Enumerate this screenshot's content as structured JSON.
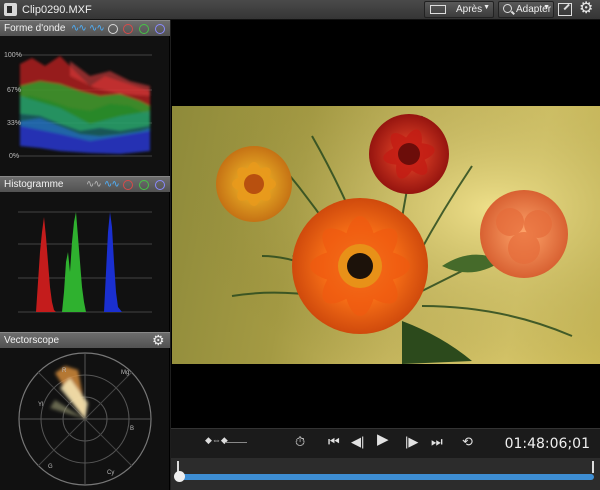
{
  "window": {
    "file_name": "Clip0290.MXF",
    "view_label": "Après",
    "fit_label": "Adapter",
    "app_icon": "clip-viewer-icon",
    "settings_icon": "gear-icon",
    "external_icon": "external-monitor-icon"
  },
  "waveform": {
    "title": "Forme d'onde",
    "levels": [
      "100%",
      "67%",
      "33%",
      "0%"
    ],
    "modes": [
      "rgb-parade-wave-icon",
      "luma-wave-icon"
    ],
    "channels": [
      "white",
      "red",
      "green",
      "blue"
    ],
    "colors": {
      "white": "#d8d8d8",
      "red": "#d84a4a",
      "green": "#46c446",
      "blue": "#6a6aff"
    }
  },
  "histogram": {
    "title": "Histogramme",
    "modes": [
      "luma-wave-icon",
      "rgb-wave-icon"
    ],
    "channels": [
      "red",
      "green",
      "blue"
    ]
  },
  "vectorscope": {
    "title": "Vectorscope",
    "targets": [
      "R",
      "Mg",
      "B",
      "Cy",
      "G",
      "Yl"
    ]
  },
  "playback": {
    "timecode": "01:48:06;01",
    "position": 0.0
  }
}
